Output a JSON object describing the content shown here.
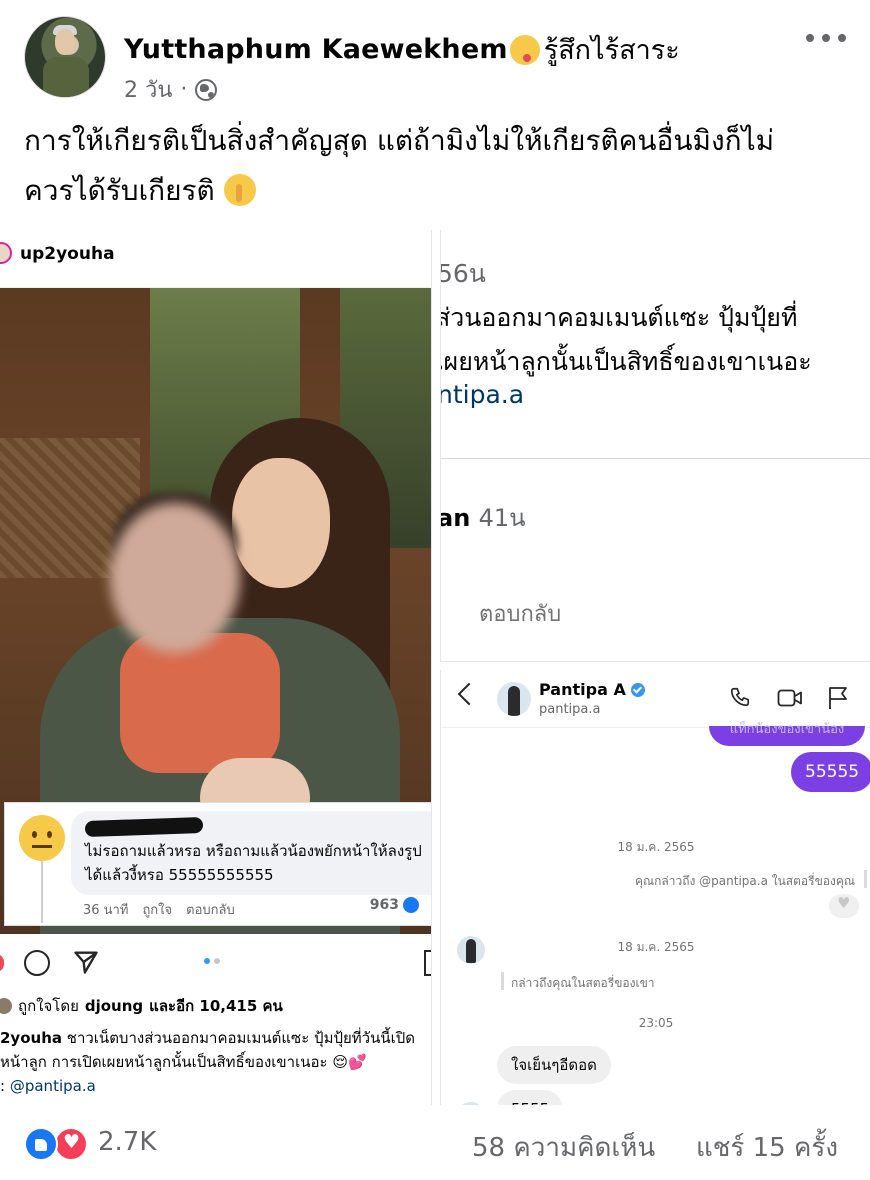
{
  "post": {
    "author": "Yutthaphum Kaewekhem",
    "feeling": "รู้สึกไร้สาระ",
    "feeling_icon": "silly-face-emoji",
    "time": "2 วัน",
    "meta_separator": "·",
    "privacy_icon": "globe-icon",
    "text_line1": "การให้เกียรติเป็นสิ่งสำคัญสุด แต่ถ้ามิงไม่ให้เกียรติคนอื่นมิงก็ไม่",
    "text_line2": "ควรได้รับเกียรติ"
  },
  "instagram_post": {
    "username": "up2youha",
    "comment_text_line1": "ไม่รอถามแล้วหรอ หรือถามแล้วน้องพยักหน้าให้ลงรูป",
    "comment_text_line2": "ได้แล้วงี้หรอ 55555555555",
    "comment_time": "36 นาที",
    "comment_like": "ถูกใจ",
    "comment_reply": "ตอบกลับ",
    "comment_reactions": "963",
    "likes_prefix": "ถูกใจโดย",
    "likes_user": "djoung",
    "likes_suffix": "และอีก 10,415 คน",
    "caption_user": "2youha",
    "caption_line1": "ชาวเน็ตบางส่วนออกมาคอมเมนต์แซะ ปุ้มปุ้ยที่วันนี้เปิด",
    "caption_line2": "หน้าลูก การเปิดเผยหน้าลูกนั้นเป็นสิทธิ์ของเขาเนอะ 😌💕",
    "caption_line3_prefix": ":",
    "caption_mention": "@pantipa.a"
  },
  "thread": {
    "time1": "56น",
    "text_line1": "ส่วนออกมาคอมเมนต์แซะ ปุ้มปุ้ยที่",
    "text_line2": "เผยหน้าลูกนั้นเป็นสิทธิ์ของเขาเนอะ",
    "handle": "ntipa.a",
    "user2": "an",
    "time2": "41น",
    "reply": "ตอบกลับ"
  },
  "dm": {
    "name": "Pantipa A",
    "handle": "pantipa.a",
    "cut_bubble_text": "แท็กน้องของเขาน้อง",
    "sent_message": "55555",
    "date1": "18 ม.ค. 2565",
    "mention_sent": "คุณกล่าวถึง @pantipa.a ในสตอรี่ของคุณ",
    "date2": "18 ม.ค. 2565",
    "mention_received": "กล่าวถึงคุณในสตอรี่ของเขา",
    "time": "23:05",
    "received_1": "ใจเย็นๆอีดอด",
    "received_2": "5555"
  },
  "footer": {
    "reactions_count": "2.7K",
    "comments": "58 ความคิดเห็น",
    "shares": "แชร์ 15 ครั้ง"
  },
  "colors": {
    "facebook_blue": "#1877f2",
    "love_red": "#f33e58",
    "dm_purple": "#7b3fe4",
    "secondary_text": "#65676b"
  }
}
